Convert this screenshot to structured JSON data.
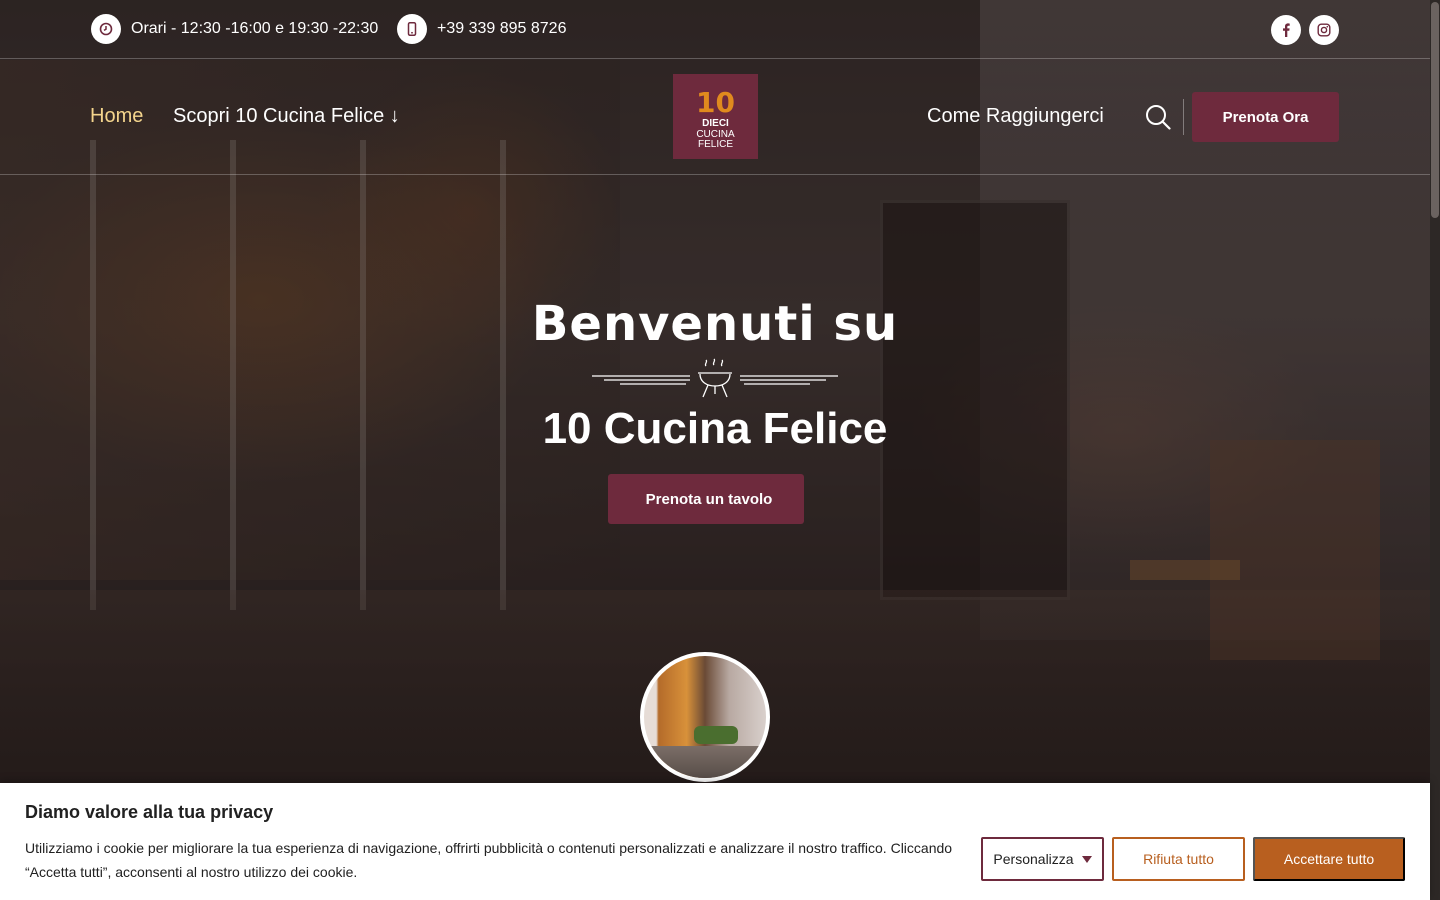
{
  "topbar": {
    "hours": "Orari - 12:30 -16:00 e 19:30 -22:30",
    "phone": "+39 339 895 8726",
    "hours_icon": "clock-icon",
    "phone_icon": "mobile-phone-icon",
    "social": [
      "facebook-icon",
      "instagram-icon"
    ]
  },
  "nav": {
    "home": "Home",
    "discover": "Scopri 10 Cucina Felice ↓",
    "directions": "Come Raggiungerci",
    "book_now": "Prenota Ora",
    "logo": {
      "number": "10",
      "line1": "DIECI",
      "line2": "CUCINA",
      "line3": "FELICE"
    }
  },
  "hero": {
    "title": "Benvenuti su",
    "subtitle": "10 Cucina Felice",
    "button": "Prenota un tavolo",
    "button_icon": ""
  },
  "cookie": {
    "title": "Diamo valore alla tua privacy",
    "text": "Utilizziamo i cookie per migliorare la tua esperienza di navigazione, offrirti pubblicità o contenuti personalizzati e analizzare il nostro traffico. Cliccando “Accetta tutti”, acconsenti al nostro utilizzo dei cookie.",
    "customize": "Personalizza",
    "reject": "Rifiuta tutto",
    "accept": "Accettare tutto"
  },
  "colors": {
    "brand": "#6e2a3d",
    "accent": "#b85f1f",
    "active_nav": "#f4d58d"
  }
}
